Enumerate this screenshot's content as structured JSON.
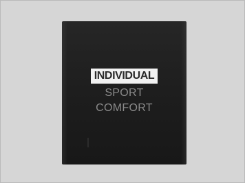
{
  "drive_mode_menu": {
    "items": [
      {
        "label": "INDIVIDUAL",
        "selected": true
      },
      {
        "label": "SPORT",
        "selected": false
      },
      {
        "label": "COMFORT",
        "selected": false
      }
    ]
  },
  "colors": {
    "background": "#d6d6d6",
    "screen": "#1d1d1d",
    "selected_highlight": "#f2f2f2",
    "inactive_text": "#8a8a8a"
  }
}
